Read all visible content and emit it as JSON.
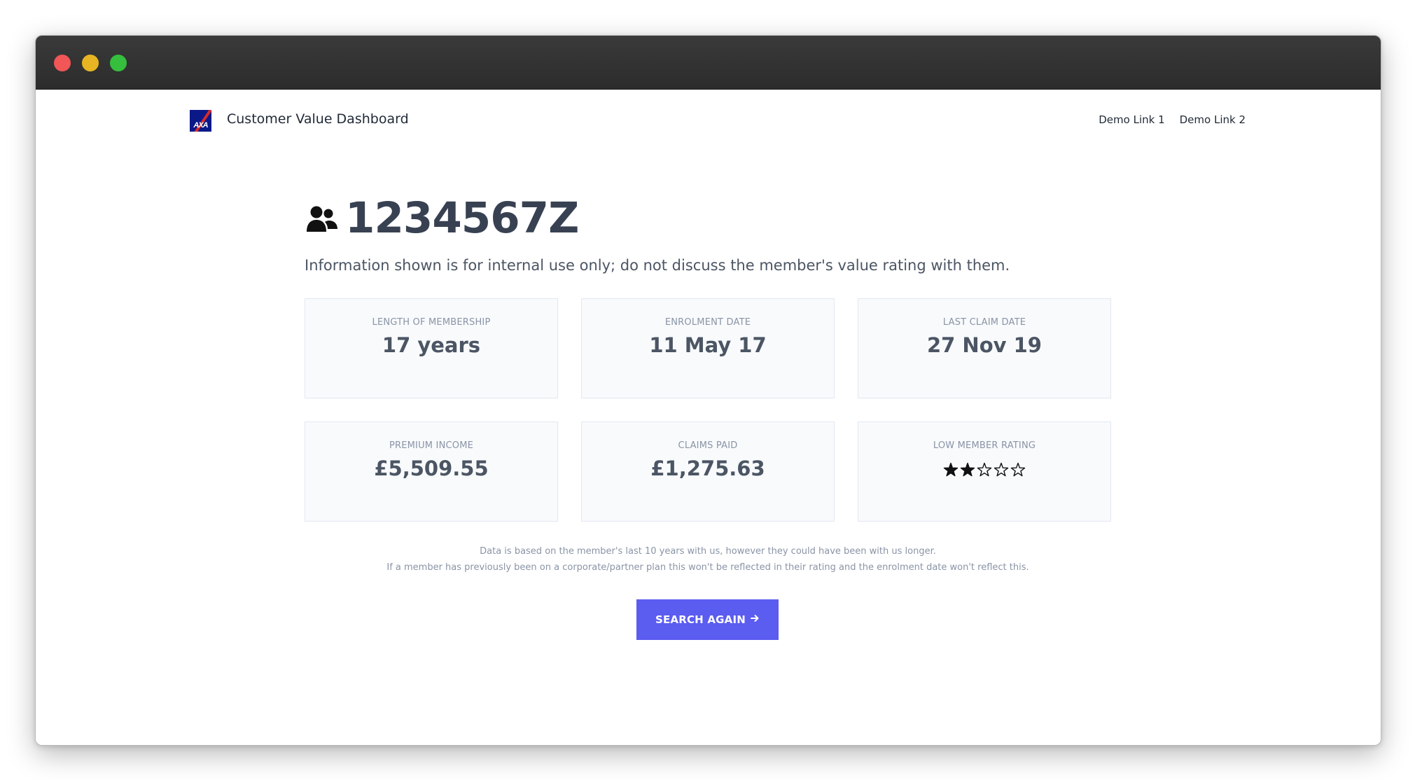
{
  "window": {
    "controls": [
      "close",
      "minimize",
      "maximize"
    ],
    "colors": {
      "close": "#f25656",
      "minimize": "#e7b523",
      "maximize": "#35bf3d"
    }
  },
  "header": {
    "logo_text": "AXA",
    "app_title": "Customer Value Dashboard",
    "nav_links": [
      "Demo Link 1",
      "Demo Link 2"
    ]
  },
  "member": {
    "icon": "users-icon",
    "id": "1234567Z",
    "notice": "Information shown is for internal use only; do not discuss the member's value rating with them."
  },
  "stats": [
    {
      "label": "LENGTH OF MEMBERSHIP",
      "value": "17 years"
    },
    {
      "label": "ENROLMENT DATE",
      "value": "11 May 17"
    },
    {
      "label": "LAST CLAIM DATE",
      "value": "27 Nov 19"
    },
    {
      "label": "PREMIUM INCOME",
      "value": "£5,509.55"
    },
    {
      "label": "CLAIMS PAID",
      "value": "£1,275.63"
    }
  ],
  "rating": {
    "label": "LOW MEMBER RATING",
    "filled": 2,
    "max": 5
  },
  "footnotes": [
    "Data is based on the member's last 10 years with us, however they could have been with us longer.",
    "If a member has previously been on a corporate/partner plan this won't be reflected in their rating and the enrolment date won't reflect this."
  ],
  "action": {
    "search_again_label": "SEARCH AGAIN",
    "icon": "arrow-right-icon",
    "color": "#5b5cf0"
  }
}
